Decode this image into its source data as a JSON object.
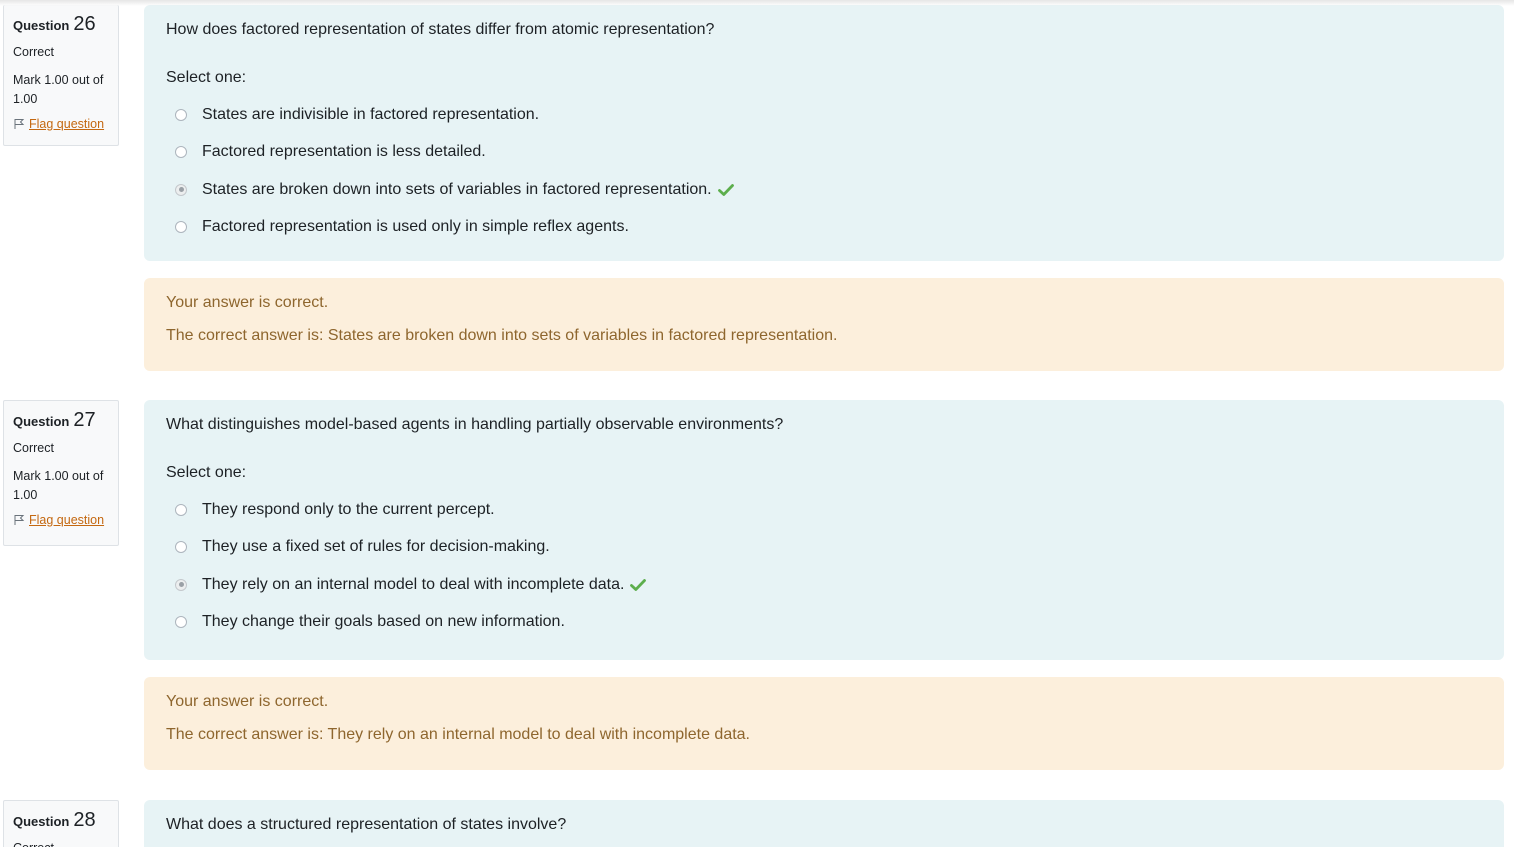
{
  "questions": [
    {
      "label": "Question",
      "number": "26",
      "state": "Correct",
      "grade": "Mark 1.00 out of 1.00",
      "flag_label": "Flag question",
      "text": "How does factored representation of states differ from atomic representation?",
      "prompt": "Select one:",
      "options": [
        {
          "text": "States are indivisible in factored representation.",
          "selected": false,
          "correct": false
        },
        {
          "text": "Factored representation is less detailed.",
          "selected": false,
          "correct": false
        },
        {
          "text": "States are broken down into sets of variables in factored representation.",
          "selected": true,
          "correct": true
        },
        {
          "text": "Factored representation is used only in simple reflex agents.",
          "selected": false,
          "correct": false
        }
      ],
      "feedback": "Your answer is correct.",
      "right_answer": "The correct answer is: States are broken down into sets of variables in factored representation."
    },
    {
      "label": "Question",
      "number": "27",
      "state": "Correct",
      "grade": "Mark 1.00 out of 1.00",
      "flag_label": "Flag question",
      "text": "What distinguishes model-based agents in handling partially observable environments?",
      "prompt": "Select one:",
      "options": [
        {
          "text": "They respond only to the current percept.",
          "selected": false,
          "correct": false
        },
        {
          "text": "They use a fixed set of rules for decision-making.",
          "selected": false,
          "correct": false
        },
        {
          "text": "They rely on an internal model to deal with incomplete data.",
          "selected": true,
          "correct": true
        },
        {
          "text": "They change their goals based on new information.",
          "selected": false,
          "correct": false
        }
      ],
      "feedback": "Your answer is correct.",
      "right_answer": "The correct answer is: They rely on an internal model to deal with incomplete data."
    },
    {
      "label": "Question",
      "number": "28",
      "state": "Correct",
      "text": "What does a structured representation of states involve?"
    }
  ],
  "colors": {
    "formulation_bg": "#e7f3f5",
    "outcome_bg": "#fcefdc",
    "outcome_text": "#8e662e",
    "flag_link": "#c46810",
    "tick": "#5cae4c"
  },
  "icons": {
    "flag": "flag-icon",
    "tick": "check-icon"
  }
}
